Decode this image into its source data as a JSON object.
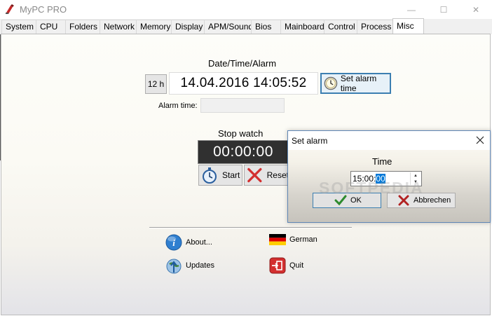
{
  "window": {
    "title": "MyPC PRO",
    "buttons": {
      "minimize": "—",
      "maximize": "☐",
      "close": "✕"
    }
  },
  "tabs": [
    {
      "label": "System"
    },
    {
      "label": "CPU"
    },
    {
      "label": "Folders"
    },
    {
      "label": "Network"
    },
    {
      "label": "Memory"
    },
    {
      "label": "Display"
    },
    {
      "label": "APM/Sound"
    },
    {
      "label": "Bios"
    },
    {
      "label": "Mainboard"
    },
    {
      "label": "Control"
    },
    {
      "label": "Process"
    },
    {
      "label": "Misc",
      "active": true
    }
  ],
  "datetime": {
    "heading": "Date/Time/Alarm",
    "mode_button": "12 h",
    "clock": "14.04.2016 14:05:52",
    "set_alarm_button": "Set alarm time",
    "alarm_time_label": "Alarm time:",
    "alarm_time_value": ""
  },
  "stopwatch": {
    "heading": "Stop watch",
    "display": "00:00:00",
    "start_button": "Start",
    "reset_button": "Reset"
  },
  "links": {
    "about": "About...",
    "updates": "Updates",
    "language": "German",
    "quit": "Quit"
  },
  "dialog": {
    "title": "Set alarm",
    "time_label": "Time",
    "time_value_prefix": "15:00:",
    "time_value_selected": "00",
    "ok_button": "OK",
    "cancel_button": "Abbrechen",
    "watermark": "SOFTPEDIA"
  },
  "colors": {
    "accent": "#3c7fb1",
    "selection": "#0078d7",
    "stopwatch_bg": "#303030"
  }
}
